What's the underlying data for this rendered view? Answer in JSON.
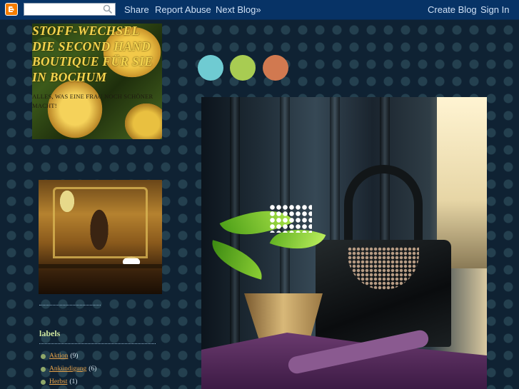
{
  "navbar": {
    "search": {
      "value": "",
      "placeholder": ""
    },
    "links": {
      "share": "Share",
      "report_abuse": "Report Abuse",
      "next_blog": "Next Blog»",
      "create_blog": "Create Blog",
      "sign_in": "Sign In"
    }
  },
  "header": {
    "title": "STOFF-WECHSEL DIE SECOND HAND BOUTIQUE FÜR SIE IN BOCHUM",
    "description": "ALLES, WAS EINE FRAU NOCH SCHÖNER MACHT!"
  },
  "circles": {
    "colors": [
      "#6fcbd2",
      "#a8cc52",
      "#d17950"
    ]
  },
  "sidebar": {
    "labels_title": "labels",
    "labels": [
      {
        "name": "Aktion",
        "count": "(9)"
      },
      {
        "name": "Ankündigung",
        "count": "(6)"
      },
      {
        "name": "Herbst",
        "count": "(1)"
      }
    ]
  }
}
